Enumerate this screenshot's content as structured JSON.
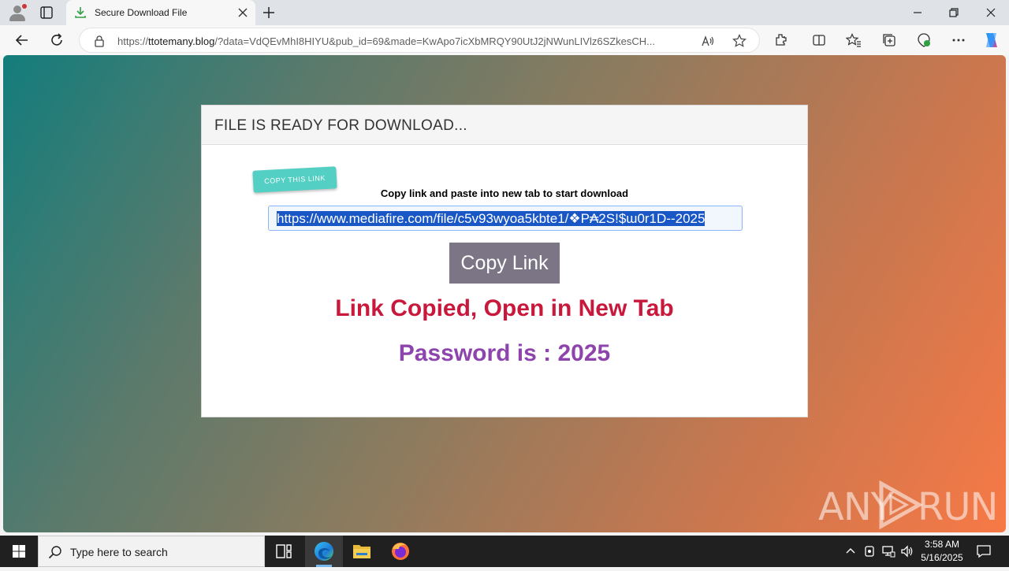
{
  "browser": {
    "tab": {
      "title": "Secure Download File"
    },
    "address": {
      "scheme": "https://",
      "host": "ttotemany.blog",
      "path": "/?data=VdQEvMhI8HIYU&pub_id=69&made=KwApo7icXbMRQY90UtJ2jNWunLIVlz6SZkesCH..."
    }
  },
  "page": {
    "card_title": "FILE IS READY FOR DOWNLOAD...",
    "copy_tag": "COPY THIS LINK",
    "instructions": "Copy link and paste into new tab to start download",
    "download_link": "https://www.mediafire.com/file/c5v93wyoa5kbte1/❖P₳2S!$ɯ0r1D--2025",
    "copy_button": "Copy Link",
    "status_message": "Link Copied, Open in New Tab",
    "password_message": "Password is : 2025"
  },
  "watermark": {
    "left": "ANY",
    "right": "RUN"
  },
  "taskbar": {
    "search_placeholder": "Type here to search",
    "time": "3:58 AM",
    "date": "5/16/2025"
  },
  "colors": {
    "status": "#c8193c",
    "password": "#8e44ad",
    "copy_tag": "#54cfc3",
    "button": "#7b7585"
  }
}
